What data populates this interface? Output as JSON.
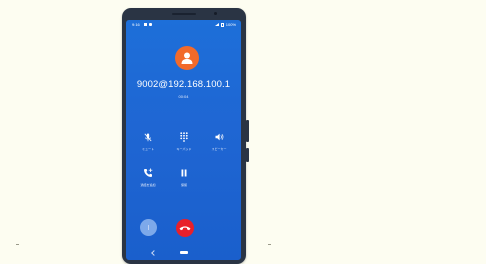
{
  "status_bar": {
    "time": "9:16",
    "battery": "100%"
  },
  "call": {
    "number": "9002@192.168.100.1",
    "timer": "00:04"
  },
  "controls": [
    {
      "label": "ミュート",
      "icon": "mic-off-icon"
    },
    {
      "label": "キーパッド",
      "icon": "dialpad-icon"
    },
    {
      "label": "スピーカー",
      "icon": "speaker-icon"
    },
    {
      "label": "通話を追加",
      "icon": "add-call-icon"
    },
    {
      "label": "保留",
      "icon": "pause-icon"
    }
  ],
  "colors": {
    "screen_blue": "#1f66d3",
    "avatar_orange": "#f26a2b",
    "hangup_red": "#e8202a",
    "page_bg": "#fdfdf1"
  }
}
